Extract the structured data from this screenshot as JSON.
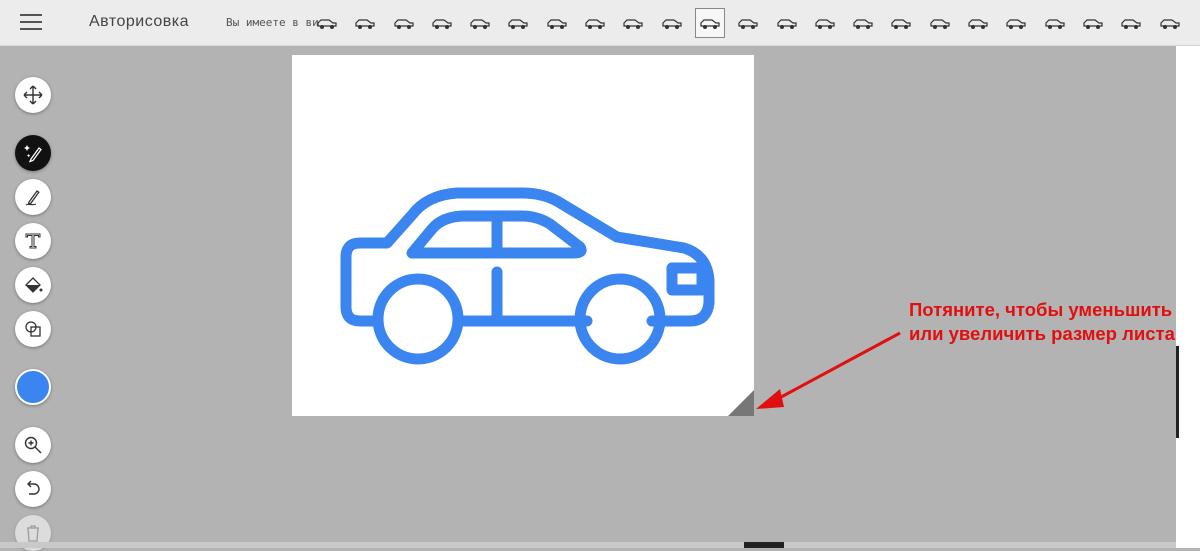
{
  "header": {
    "menu_icon": "hamburger-icon",
    "title": "Авторисовка",
    "hint": "Вы имеете в ви",
    "vehicles": [
      "sedan-front-icon",
      "sports-car-icon",
      "car-top-icon",
      "limo-top-icon",
      "pickup-icon",
      "race-car-icon",
      "beetle-icon",
      "coupe-icon",
      "hatchback-icon",
      "suv-icon",
      "sedan-side-icon",
      "bus-icon",
      "bus-front-icon",
      "fire-truck-icon",
      "semi-truck-icon",
      "tow-truck-icon",
      "truck-front-icon",
      "roadster-icon",
      "van-front-icon",
      "station-wagon-icon",
      "minivan-icon",
      "bus-front-icon-2",
      "limousine-icon"
    ],
    "selected_vehicle_index": 10
  },
  "toolbar": {
    "tools": [
      {
        "name": "move-tool",
        "icon": "move-arrows-icon"
      },
      {
        "name": "autodraw-tool",
        "icon": "magic-pen-icon",
        "active": true
      },
      {
        "name": "draw-tool",
        "icon": "pencil-icon"
      },
      {
        "name": "type-tool",
        "icon": "text-t-icon"
      },
      {
        "name": "fill-tool",
        "icon": "paint-bucket-icon"
      },
      {
        "name": "shape-tool",
        "icon": "shapes-icon"
      },
      {
        "name": "color-picker",
        "icon": "color-swatch",
        "color": "#3b85f0"
      },
      {
        "name": "zoom-tool",
        "icon": "zoom-icon"
      },
      {
        "name": "undo-tool",
        "icon": "undo-icon"
      },
      {
        "name": "delete-tool",
        "icon": "trash-icon"
      }
    ]
  },
  "canvas": {
    "drawing": "car-drawing",
    "stroke_color": "#3b85f0"
  },
  "annotation": {
    "text": "Потяните, чтобы уменьшить или увеличить размер листа",
    "color": "#e01010"
  }
}
